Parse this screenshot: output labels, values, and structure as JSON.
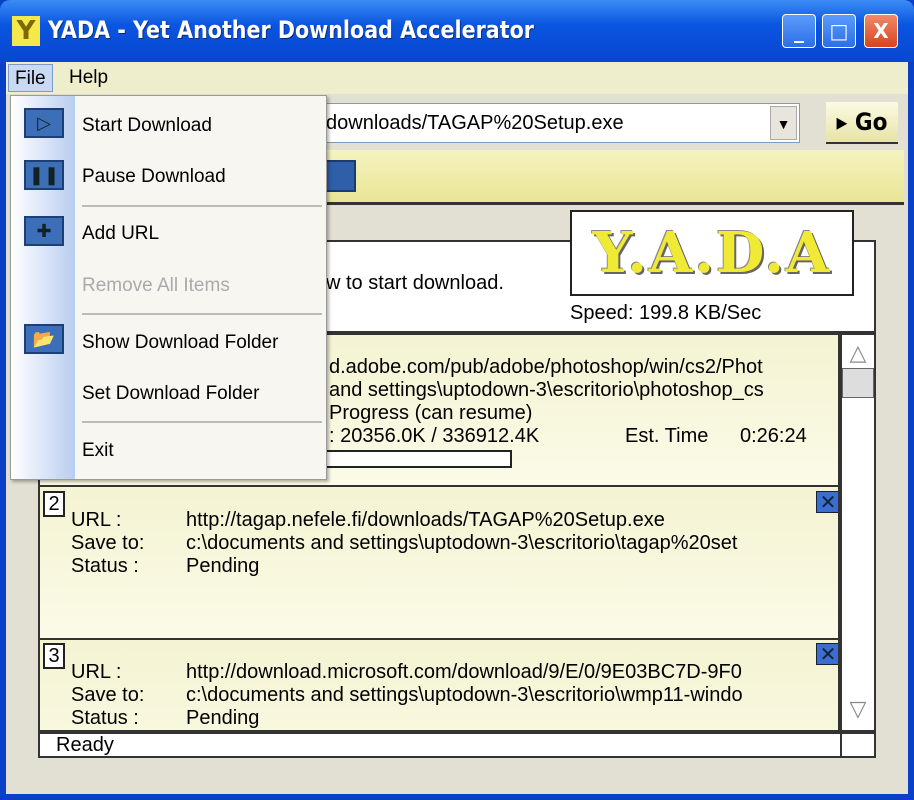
{
  "window": {
    "title": "YADA - Yet Another Download Accelerator",
    "app_icon": "Y",
    "minimize": "_",
    "maximize": "□",
    "close": "X"
  },
  "menubar": {
    "items": [
      {
        "label": "File"
      },
      {
        "label": "Help"
      }
    ]
  },
  "file_menu": {
    "items": [
      {
        "label": "Start Download",
        "icon": "play-icon",
        "enabled": true
      },
      {
        "label": "Pause Download",
        "icon": "pause-icon",
        "enabled": true
      },
      {
        "label": "Add URL",
        "icon": "add-icon",
        "enabled": true
      },
      {
        "label": "Remove All Items",
        "enabled": false
      },
      {
        "label": "Show Download Folder",
        "icon": "open-folder-icon",
        "enabled": true
      },
      {
        "label": "Set Download Folder",
        "enabled": true
      },
      {
        "label": "Exit",
        "enabled": true
      }
    ]
  },
  "url_bar": {
    "value": "downloads/TAGAP%20Setup.exe",
    "go_label": "▸ Go"
  },
  "panel": {
    "message": "w to start download.",
    "logo": "Y.A.D.A",
    "speed": "Speed: 199.8  KB/Sec"
  },
  "downloads": [
    {
      "url_fragment": "d.adobe.com/pub/adobe/photoshop/win/cs2/Phot",
      "save_fragment": " and settings\\uptodown-3\\escritorio\\photoshop_cs",
      "status_fragment": "Progress (can resume)",
      "size_fragment": ": 20356.0K / 336912.4K",
      "est_time_label": "Est. Time",
      "est_time": "0:26:24",
      "progress_percent": 6
    },
    {
      "number": "2",
      "url_label": "URL :",
      "url": "http://tagap.nefele.fi/downloads/TAGAP%20Setup.exe",
      "save_label": "Save to:",
      "save": "c:\\documents and settings\\uptodown-3\\escritorio\\tagap%20set",
      "status_label": "Status :",
      "status": "Pending"
    },
    {
      "number": "3",
      "url_label": "URL :",
      "url": "http://download.microsoft.com/download/9/E/0/9E03BC7D-9F0",
      "save_label": "Save to:",
      "save": "c:\\documents and settings\\uptodown-3\\escritorio\\wmp11-windo",
      "status_label": "Status :",
      "status": "Pending"
    }
  ],
  "statusbar": {
    "text": "Ready"
  }
}
